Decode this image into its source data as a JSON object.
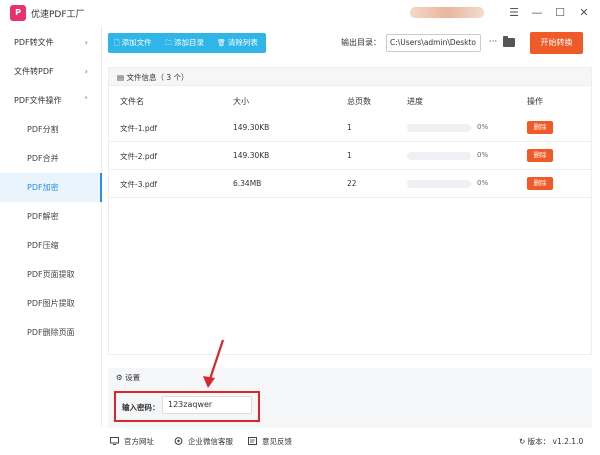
{
  "app": {
    "title": "优速PDF工厂",
    "logo_text": "P"
  },
  "window": {
    "menu_icon": "☰",
    "minimize_icon": "—",
    "maximize_icon": "☐",
    "close_icon": "✕"
  },
  "sidebar": {
    "groups": [
      {
        "label": "PDF转文件",
        "chevron": "›"
      },
      {
        "label": "文件转PDF",
        "chevron": "›"
      },
      {
        "label": "PDF文件操作",
        "chevron": "˄"
      }
    ],
    "items": [
      {
        "label": "PDF分割"
      },
      {
        "label": "PDF合并"
      },
      {
        "label": "PDF加密"
      },
      {
        "label": "PDF解密"
      },
      {
        "label": "PDF压缩"
      },
      {
        "label": "PDF页面提取"
      },
      {
        "label": "PDF图片提取"
      },
      {
        "label": "PDF删除页面"
      }
    ],
    "active_item": "PDF加密"
  },
  "toolbar": {
    "add_file": "添加文件",
    "add_folder": "添加目录",
    "clear_list": "清除列表",
    "output_label": "输出目录：",
    "output_path": "C:\\Users\\admin\\Deskto",
    "browse": "···",
    "start": "开始转换"
  },
  "file_panel": {
    "header": "文件信息（ 3 个）",
    "columns": [
      "文件名",
      "大小",
      "总页数",
      "进度",
      "操作"
    ],
    "rows": [
      {
        "name": "文件-1.pdf",
        "size": "149.30KB",
        "pages": "1",
        "progress": "0%",
        "progress_value": 0,
        "action": "删除"
      },
      {
        "name": "文件-2.pdf",
        "size": "149.30KB",
        "pages": "1",
        "progress": "0%",
        "progress_value": 0,
        "action": "删除"
      },
      {
        "name": "文件-3.pdf",
        "size": "6.34MB",
        "pages": "22",
        "progress": "0%",
        "progress_value": 0,
        "action": "删除"
      }
    ]
  },
  "settings": {
    "title": "设置",
    "password_label": "输入密码：",
    "password_value": "123zaqwer"
  },
  "footer": {
    "website": "官方网址",
    "wechat": "企业微信客服",
    "feedback": "意见反馈",
    "version": "版本：  v1.2.1.0"
  },
  "colors": {
    "accent": "#2fb5e8",
    "primary": "#2d8cf0",
    "start_button": "#f05a28",
    "delete_button": "#f05a28",
    "highlight": "#d9262c"
  }
}
